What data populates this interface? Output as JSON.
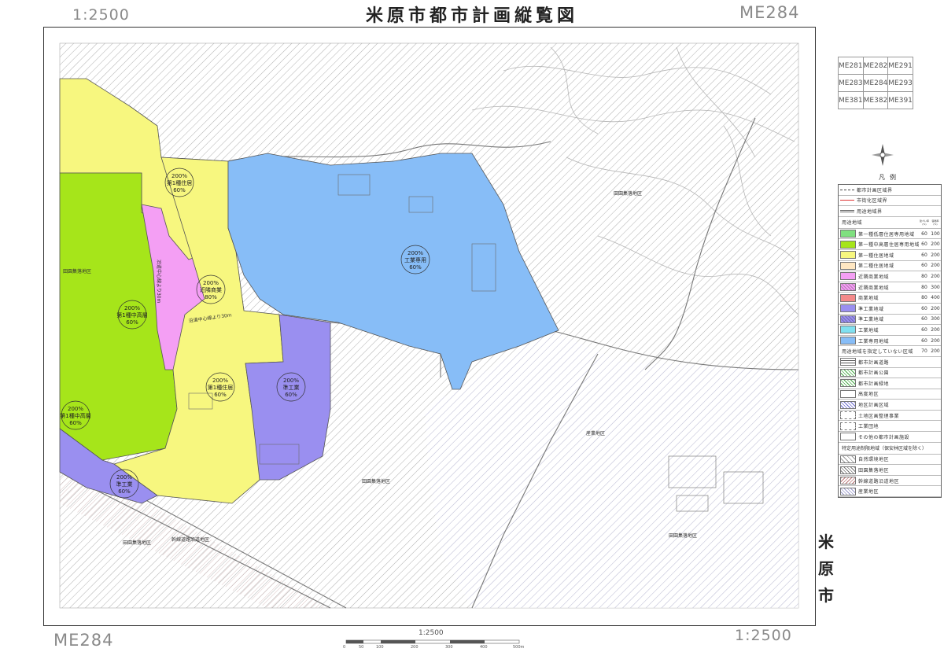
{
  "header": {
    "title": "米原市都市計画縦覧図",
    "scale_top_left": "1:2500",
    "sheet_top_right": "ME284"
  },
  "footer": {
    "sheet_bottom_left": "ME284",
    "scale_bottom_right": "1:2500",
    "scale_bar_label": "1:2500",
    "scale_bar_ticks": [
      "0",
      "50",
      "100",
      "200",
      "300",
      "400",
      "500m"
    ]
  },
  "side_city": [
    "米",
    "原",
    "市"
  ],
  "sheet_index": [
    [
      "ME281",
      "ME282",
      "ME291"
    ],
    [
      "ME283",
      "ME284",
      "ME293"
    ],
    [
      "ME381",
      "ME382",
      "ME391"
    ]
  ],
  "colors": {
    "dai1_teiso": "#7fe07f",
    "dai1_chuko": "#a6e51a",
    "dai1_jukyo": "#f7f77f",
    "dai2_jukyo": "#ffe7c2",
    "kinrin_shogyo": "#f49ff4",
    "shogyo": "#f48a8a",
    "jun_kogyo": "#9a8ff0",
    "kogyo": "#80e0f0",
    "kogyo_senyo": "#87bdf7",
    "hatch": "#888888"
  },
  "map_labels": {
    "zone_a": [
      "200%",
      "第1種住居",
      "60%"
    ],
    "zone_b": [
      "200%",
      "工業専用",
      "60%"
    ],
    "zone_c": [
      "200%",
      "近隣商業",
      "80%"
    ],
    "zone_d": [
      "200%",
      "第1種中高層",
      "60%"
    ],
    "zone_e": [
      "200%",
      "第1種住居",
      "60%"
    ],
    "zone_f": [
      "200%",
      "準工業",
      "60%"
    ],
    "zone_g": [
      "200%",
      "第1種中高層",
      "60%"
    ],
    "zone_h": [
      "200%",
      "準工業",
      "60%"
    ],
    "place_1": "田園集落地区",
    "place_2": "田園集落地区",
    "place_3": "田園集落地区",
    "place_4": "田園集落地区",
    "place_5": "産業地区",
    "place_6": "田園集落地区",
    "place_7": "幹線道路沿道地区",
    "road_1": "沿道中心線より30m",
    "road_2": "沿道中心線より30m"
  },
  "legend": {
    "title": "凡例",
    "lines": [
      {
        "label": "都市計画区域界",
        "style": "dashed"
      },
      {
        "label": "市街化区域界",
        "style": "red"
      },
      {
        "label": "用途地域界",
        "style": "double"
      }
    ],
    "zone_header": {
      "label": "用途地域",
      "col1": "建ぺい率(%)",
      "col2": "容積率(%)"
    },
    "zones": [
      {
        "label": "第一種低層住居専用地域",
        "color_key": "dai1_teiso",
        "r1": "60",
        "r2": "100"
      },
      {
        "label": "第一種中高層住居専用地域",
        "color_key": "dai1_chuko",
        "r1": "60",
        "r2": "200"
      },
      {
        "label": "第一種住居地域",
        "color_key": "dai1_jukyo",
        "r1": "60",
        "r2": "200"
      },
      {
        "label": "第二種住居地域",
        "color_key": "dai2_jukyo",
        "r1": "60",
        "r2": "200"
      },
      {
        "label": "近隣商業地域",
        "color_key": "kinrin_shogyo",
        "r1": "80",
        "r2": "200"
      },
      {
        "label": "近隣商業地域",
        "color_key": "kinrin_shogyo",
        "r1": "80",
        "r2": "300"
      },
      {
        "label": "商業地域",
        "color_key": "shogyo",
        "r1": "80",
        "r2": "400"
      },
      {
        "label": "準工業地域",
        "color_key": "jun_kogyo",
        "r1": "60",
        "r2": "200"
      },
      {
        "label": "準工業地域",
        "color_key": "jun_kogyo",
        "r1": "60",
        "r2": "300"
      },
      {
        "label": "工業地域",
        "color_key": "kogyo",
        "r1": "60",
        "r2": "200"
      },
      {
        "label": "工業専用地域",
        "color_key": "kogyo_senyo",
        "r1": "60",
        "r2": "200"
      }
    ],
    "unzoned": {
      "label": "用途地域を指定していない区域",
      "r1": "70",
      "r2": "200"
    },
    "facilities": [
      {
        "label": "都市計画道路",
        "style": "road"
      },
      {
        "label": "都市計画公園",
        "style": "park"
      },
      {
        "label": "都市計画緑地",
        "style": "green"
      },
      {
        "label": "高度地区",
        "style": "plain"
      },
      {
        "label": "地区計画区域",
        "style": "cross"
      },
      {
        "label": "土地区画整理事業",
        "style": "dots"
      },
      {
        "label": "工業団地",
        "style": "dash"
      },
      {
        "label": "その他の都市計画施設",
        "style": "plain"
      }
    ],
    "special_header": "特定用途制限地域（保安林区域を除く）",
    "special": [
      {
        "label": "自然環境地区",
        "style": "h1"
      },
      {
        "label": "田園集落地区",
        "style": "h2"
      },
      {
        "label": "幹線道路沿道地区",
        "style": "h3"
      },
      {
        "label": "産業地区",
        "style": "h4"
      }
    ]
  }
}
